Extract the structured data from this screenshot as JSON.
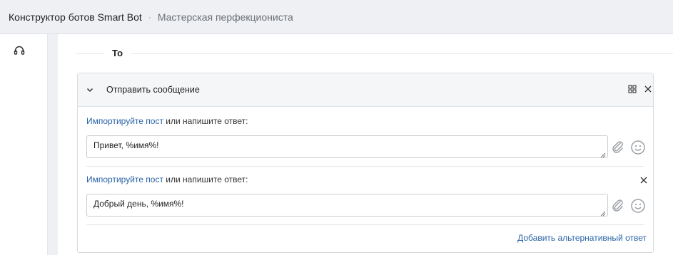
{
  "header": {
    "app_title": "Конструктор ботов Smart Bot",
    "separator": "·",
    "subtitle": "Мастерская перфекциониста"
  },
  "sidebar": {
    "icons": [
      "headset-icon"
    ]
  },
  "flow": {
    "branch_label": "То"
  },
  "action_card": {
    "title": "Отправить сообщение",
    "header_icons": [
      "copy-icon",
      "close-icon"
    ],
    "answers": [
      {
        "prompt_link": "Импортируйте пост",
        "prompt_rest": " или напишите ответ:",
        "value": "Привет, %имя%!",
        "removable": false
      },
      {
        "prompt_link": "Импортируйте пост",
        "prompt_rest": " или напишите ответ:",
        "value": "Добрый день, %имя%!",
        "removable": true
      }
    ],
    "add_alternative_label": "Добавить альтернативный ответ"
  },
  "colors": {
    "link": "#2a64a7",
    "topbar_bg": "#eef0f3",
    "card_header_bg": "#f5f6f8",
    "icon_gray": "#9aa0a6"
  }
}
